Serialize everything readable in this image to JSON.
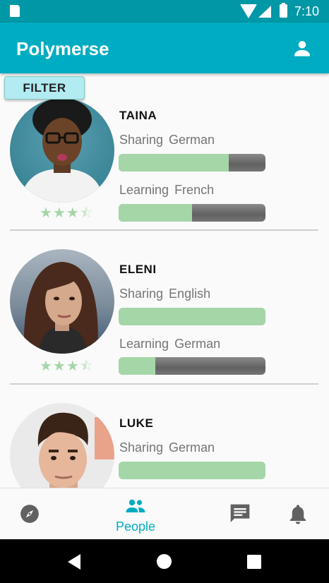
{
  "app": {
    "title": "Polymerse"
  },
  "status_bar": {
    "time": "7:10"
  },
  "filter_label": "FILTER",
  "people": [
    {
      "name": "TAINA",
      "sharing_label": "Sharing",
      "sharing_language": "German",
      "sharing_level": 0.75,
      "learning_label": "Learning",
      "learning_language": "French",
      "learning_level": 0.5,
      "rating": 3.5
    },
    {
      "name": "ELENI",
      "sharing_label": "Sharing",
      "sharing_language": "English",
      "sharing_level": 1.0,
      "learning_label": "Learning",
      "learning_language": "German",
      "learning_level": 0.25,
      "rating": 3.5
    },
    {
      "name": "LUKE",
      "sharing_label": "Sharing",
      "sharing_language": "German",
      "sharing_level": 1.0
    }
  ],
  "bottom_nav": {
    "active_label": "People",
    "active": "people",
    "items": [
      "compass-icon",
      "people-icon",
      "chat-icon",
      "bell-icon"
    ]
  },
  "colors": {
    "primary": "#00acc1",
    "primary_dark": "#0097a7",
    "progress": "#a5d6a7",
    "progress_track": "#6e6e6e"
  }
}
